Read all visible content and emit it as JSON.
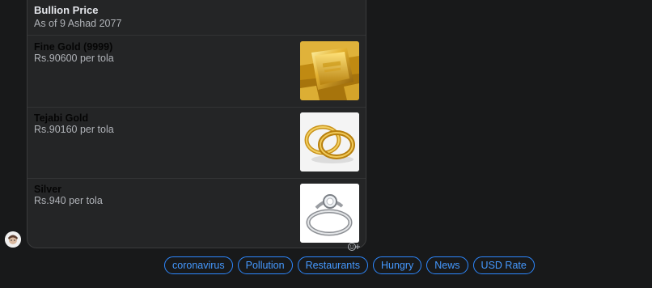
{
  "card": {
    "title": "Bullion Price",
    "subtitle": "As of 9 Ashad 2077",
    "items": [
      {
        "name": "Fine Gold (9999)",
        "price": "Rs.90600 per tola",
        "image": "gold-bar-image"
      },
      {
        "name": "Tejabi Gold",
        "price": "Rs.90160 per tola",
        "image": "gold-rings-image"
      },
      {
        "name": "Silver",
        "price": "Rs.940 per tola",
        "image": "silver-ring-image"
      }
    ]
  },
  "quick_replies": [
    "coronavirus",
    "Pollution",
    "Restaurants",
    "Hungry",
    "News",
    "USD Rate"
  ],
  "colors": {
    "background": "#18191a",
    "card": "#242526",
    "accent": "#2d88ff"
  }
}
